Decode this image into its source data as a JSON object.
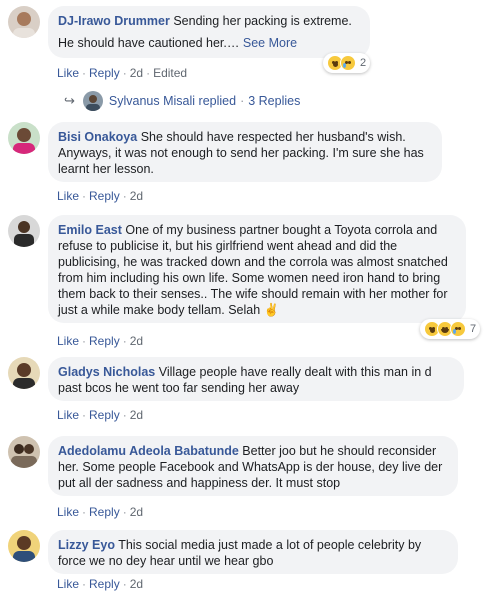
{
  "common": {
    "like": "Like",
    "reply": "Reply",
    "sep": "·"
  },
  "comments": [
    {
      "author": "DJ-Irawo Drummer",
      "text": "Sending her packing is extreme.",
      "text2": "He should have cautioned her.…",
      "see_more": "See More",
      "time": "2d",
      "edited": "Edited",
      "reaction_count": "2"
    },
    {
      "author": "Bisi Onakoya",
      "text": "She should have respected her husband's wish. Anyways, it was not enough to send her packing. I'm sure she has learnt her lesson.",
      "time": "2d"
    },
    {
      "author": "Emilo East",
      "text": "One of my business partner bought a Toyota corrola and refuse to publicise it, but his girlfriend went ahead and did the publicising, he was tracked down and the corrola was almost snatched from him including his own life. Some women need iron hand to bring them back to their senses.. The wife should remain with her mother for just a while make body tellam. Selah",
      "emoji": "✌",
      "time": "2d",
      "reaction_count": "7"
    },
    {
      "author": "Gladys Nicholas",
      "text": "Village people have really dealt with this man in d past bcos he went too far sending her away",
      "time": "2d"
    },
    {
      "author": "Adedolamu Adeola Babatunde",
      "text": "Better joo but he should reconsider her. Some people Facebook and WhatsApp is der house, dey live der put all der sadness and happiness der. It must stop",
      "time": "2d"
    },
    {
      "author": "Lizzy Eyo",
      "text": "This social media just made a lot of people celebrity by force we no dey hear until we hear gbo",
      "time": "2d"
    }
  ],
  "reply_thread": {
    "name": "Sylvanus Misali",
    "replied": "replied",
    "count": "3 Replies"
  },
  "colors": {
    "link": "#385898",
    "bubble": "#f2f3f5",
    "meta": "#606770"
  }
}
